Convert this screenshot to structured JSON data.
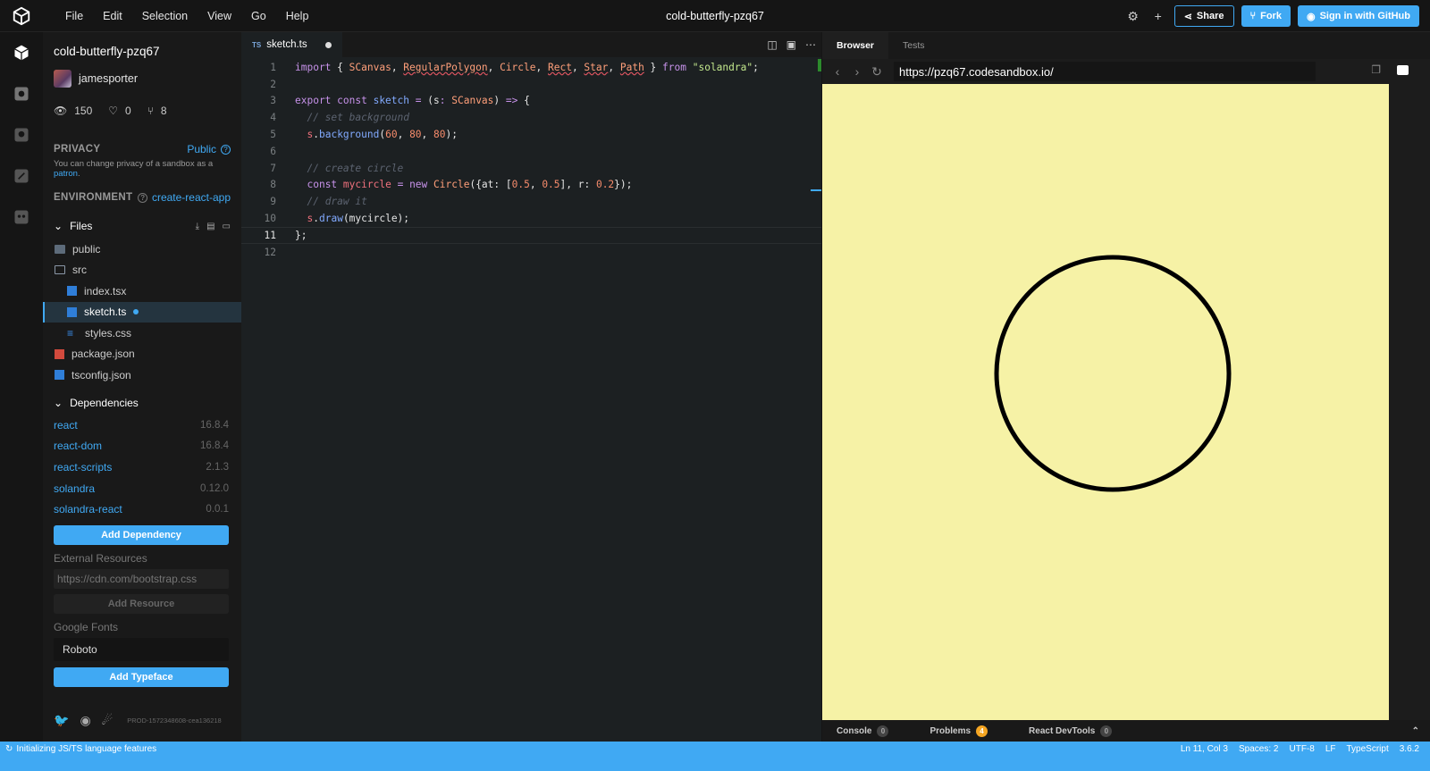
{
  "menu": [
    "File",
    "Edit",
    "Selection",
    "View",
    "Go",
    "Help"
  ],
  "app_title": "cold-butterfly-pzq67",
  "top_actions": {
    "share": "Share",
    "fork": "Fork",
    "sign_in": "Sign in with GitHub"
  },
  "sidebar": {
    "title": "cold-butterfly-pzq67",
    "author": "jamesporter",
    "stats": {
      "views": "150",
      "likes": "0",
      "forks": "8"
    },
    "privacy_label": "PRIVACY",
    "privacy_value": "Public",
    "privacy_note_prefix": "You can change privacy of a sandbox as a ",
    "privacy_note_link": "patron",
    "privacy_note_suffix": ".",
    "environment_label": "ENVIRONMENT",
    "environment_value": "create-react-app",
    "files_label": "Files",
    "files": [
      {
        "name": "public",
        "type": "folder",
        "indent": 0
      },
      {
        "name": "src",
        "type": "folder-open",
        "indent": 0
      },
      {
        "name": "index.tsx",
        "type": "tsx",
        "indent": 1
      },
      {
        "name": "sketch.ts",
        "type": "tsx",
        "indent": 1,
        "active": true,
        "modified": true
      },
      {
        "name": "styles.css",
        "type": "css",
        "indent": 1
      },
      {
        "name": "package.json",
        "type": "pkg",
        "indent": 0
      },
      {
        "name": "tsconfig.json",
        "type": "json",
        "indent": 0
      }
    ],
    "dependencies_label": "Dependencies",
    "dependencies": [
      {
        "name": "react",
        "version": "16.8.4"
      },
      {
        "name": "react-dom",
        "version": "16.8.4"
      },
      {
        "name": "react-scripts",
        "version": "2.1.3"
      },
      {
        "name": "solandra",
        "version": "0.12.0"
      },
      {
        "name": "solandra-react",
        "version": "0.0.1"
      }
    ],
    "add_dependency": "Add Dependency",
    "external_resources_label": "External Resources",
    "external_resources_placeholder": "https://cdn.com/bootstrap.css",
    "add_resource": "Add Resource",
    "google_fonts_label": "Google Fonts",
    "google_fonts_value": "Roboto",
    "add_typeface": "Add Typeface",
    "build_id": "PROD-1572348608-cea136218"
  },
  "editor": {
    "tab_lang": "TS",
    "tab_name": "sketch.ts",
    "current_line": 11
  },
  "preview": {
    "tabs": [
      "Browser",
      "Tests"
    ],
    "url": "https://pzq67.codesandbox.io/",
    "canvas_bg": "#f6f2a6",
    "bottom": [
      {
        "label": "Console",
        "count": "0"
      },
      {
        "label": "Problems",
        "count": "4"
      },
      {
        "label": "React DevTools",
        "count": "0"
      }
    ]
  },
  "status": {
    "left": "Initializing JS/TS language features",
    "right": [
      "Ln 11, Col 3",
      "Spaces: 2",
      "UTF-8",
      "LF",
      "TypeScript",
      "3.6.2"
    ]
  },
  "colors": {
    "accent": "#40a9f3",
    "canvas": "#f6f2a6"
  }
}
